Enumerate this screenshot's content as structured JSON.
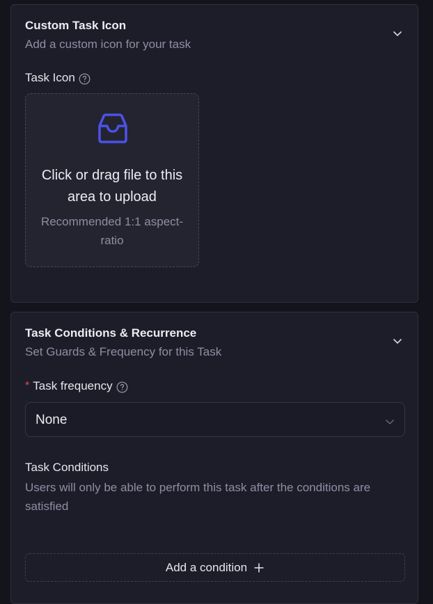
{
  "custom_icon_card": {
    "title": "Custom Task Icon",
    "subtitle": "Add a custom icon for your task",
    "field_label": "Task Icon",
    "upload": {
      "text": "Click or drag file to this area to upload",
      "hint": "Recommended 1:1 aspect-ratio",
      "icon": "inbox-icon"
    }
  },
  "conditions_card": {
    "title": "Task Conditions & Recurrence",
    "subtitle": "Set Guards & Frequency for this Task",
    "frequency": {
      "required_mark": "*",
      "label": "Task frequency",
      "value": "None"
    },
    "conditions": {
      "title": "Task Conditions",
      "description": "Users will only be able to perform this task after the conditions are satisfied"
    },
    "add_button_label": "Add a condition"
  },
  "colors": {
    "accent": "#4b52e8",
    "required": "#e5484d",
    "background": "#14141d",
    "card": "#1d1d2a"
  }
}
